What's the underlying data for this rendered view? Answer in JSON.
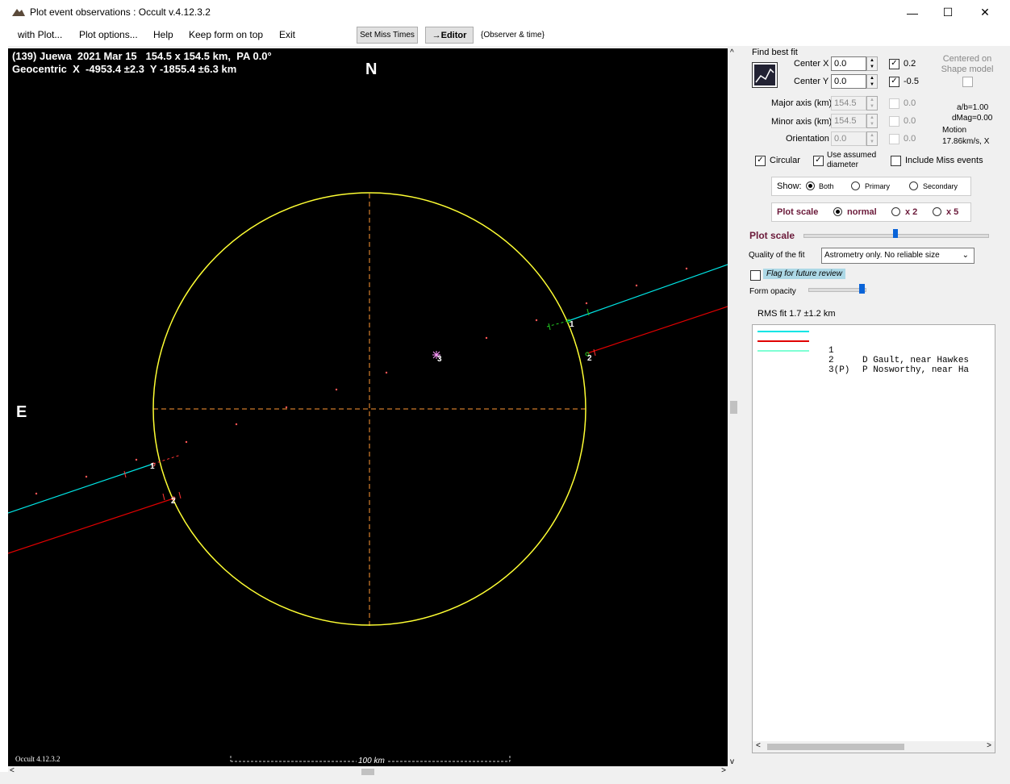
{
  "window": {
    "title": "Plot event observations : Occult v.4.12.3.2",
    "controls": [
      "—",
      "☐",
      "✕"
    ]
  },
  "menu": {
    "items": [
      "with Plot...",
      "Plot options...",
      "Help",
      "Keep form on top",
      "Exit"
    ],
    "set_miss_times": "Set Miss Times",
    "editor": "→Editor",
    "observer_time": "{Observer & time}"
  },
  "plot": {
    "header_line1": "(139) Juewa  2021 Mar 15   154.5 x 154.5 km,  PA 0.0°",
    "header_line2": "Geocentric  X  -4953.4 ±2.3  Y -1855.4 ±6.3 km",
    "north": "N",
    "east": "E",
    "scale_label": "100 km",
    "version": "Occult 4.12.3.2",
    "chord_labels": [
      "1",
      "2",
      "1",
      "2",
      "3"
    ],
    "colors": {
      "ellipse": "#ffff33",
      "chord1": "#00e5e5",
      "chord2": "#e00000",
      "axes": "#ff9933"
    }
  },
  "panel": {
    "find_best_fit": "Find best fit",
    "center_x_label": "Center X",
    "center_x": "0.0",
    "center_x_check": "0.2",
    "center_y_label": "Center Y",
    "center_y": "0.0",
    "center_y_check": "-0.5",
    "centered_on": "Centered on Shape model",
    "major_axis_label": "Major axis (km)",
    "major_axis": "154.5",
    "major_check": "0.0",
    "minor_axis_label": "Minor axis (km)",
    "minor_axis": "154.5",
    "minor_check": "0.0",
    "orientation_label": "Orientation",
    "orientation": "0.0",
    "orientation_check": "0.0",
    "ab": "a/b=1.00",
    "dmag": "dMag=0.00",
    "motion_label": "Motion",
    "motion": "17.86km/s, X",
    "circular": "Circular",
    "use_assumed": "Use assumed diameter",
    "include_miss": "Include Miss events",
    "show_label": "Show:",
    "show_options": [
      "Both",
      "Primary",
      "Secondary"
    ],
    "plot_scale_label": "Plot scale",
    "plot_scale_options": [
      "normal",
      "x 2",
      "x 5"
    ],
    "plot_scale_slider_label": "Plot scale",
    "plot_scale_slider": 0.5,
    "quality_label": "Quality of the fit",
    "quality_value": "Astrometry only. No reliable size",
    "flag_review": "Flag for future review",
    "form_opacity_label": "Form opacity",
    "form_opacity": 1.0,
    "rms_fit": "RMS fit  1.7 ±1.2 km"
  },
  "legend": {
    "rows": [
      {
        "num": "1",
        "text": "D Gault, near Hawkes",
        "color": "#00e5e5"
      },
      {
        "num": "2",
        "text": "P Nosworthy, near Ha",
        "color": "#e00000"
      },
      {
        "num": "3(P)",
        "text": "",
        "color": "#7fffd4"
      }
    ]
  }
}
